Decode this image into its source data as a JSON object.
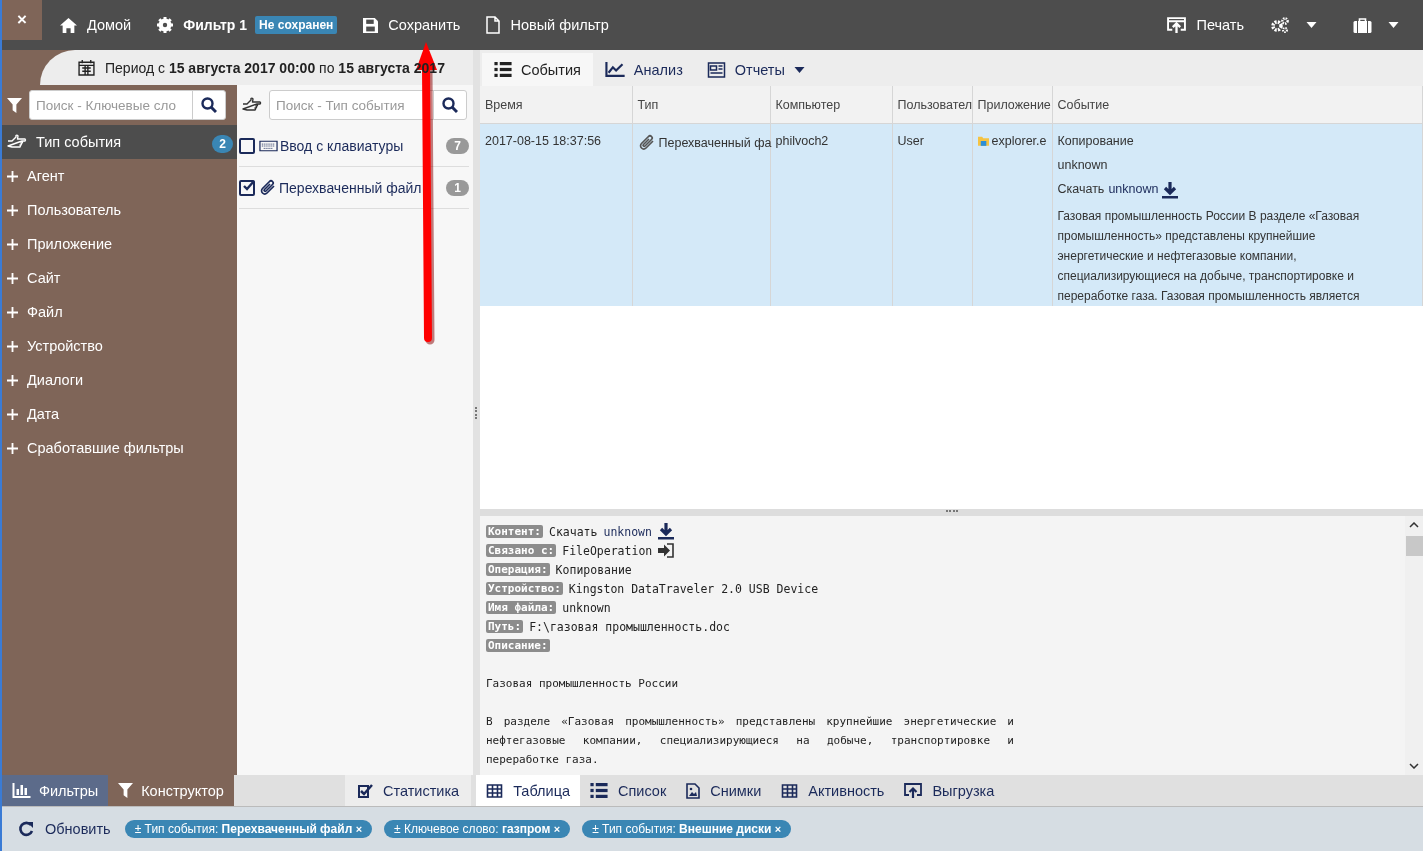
{
  "topbar": {
    "close": "×",
    "home": "Домой",
    "filter_name": "Фильтр 1",
    "filter_status": "Не сохранен",
    "save": "Сохранить",
    "new_filter": "Новый фильтр",
    "print": "Печать"
  },
  "period": "Период с **15 августа 2017 00:00** по **15 августа 2017**",
  "keyword_search": {
    "placeholder": "Поиск - Ключевые сло"
  },
  "type_search": {
    "placeholder": "Поиск - Тип события"
  },
  "sidebar": {
    "items": [
      {
        "label": "Тип события",
        "kind": "category",
        "selected": true,
        "badge": "2"
      },
      {
        "label": "Агент",
        "kind": "add",
        "selected": false
      },
      {
        "label": "Пользователь",
        "kind": "add",
        "selected": false
      },
      {
        "label": "Приложение",
        "kind": "add",
        "selected": false
      },
      {
        "label": "Сайт",
        "kind": "add",
        "selected": false
      },
      {
        "label": "Файл",
        "kind": "add",
        "selected": false
      },
      {
        "label": "Устройство",
        "kind": "add",
        "selected": false
      },
      {
        "label": "Диалоги",
        "kind": "add",
        "selected": false
      },
      {
        "label": "Дата",
        "kind": "add",
        "selected": false
      },
      {
        "label": "Сработавшие фильтры",
        "kind": "add",
        "selected": false
      }
    ]
  },
  "event_types": [
    {
      "label": "Ввод с клавиатуры",
      "kind": "keyboard",
      "count": "7",
      "checked": false
    },
    {
      "label": "Перехваченный файл",
      "kind": "attachment",
      "count": "1",
      "checked": true
    }
  ],
  "view_tabs": [
    {
      "label": "События",
      "kind": "list",
      "selected": true,
      "dropdown": false
    },
    {
      "label": "Анализ",
      "kind": "chart",
      "selected": false,
      "dropdown": false
    },
    {
      "label": "Отчеты",
      "kind": "report",
      "selected": false,
      "dropdown": true
    }
  ],
  "table": {
    "columns": [
      "Время",
      "Тип",
      "Компьютер",
      "Пользовател",
      "Приложение",
      "Событие"
    ],
    "rows": [
      {
        "selected": true,
        "time": "2017-08-15 18:37:56",
        "type": "Перехваченный фа",
        "computer": "philvoch2",
        "user": "User",
        "app": "explorer.e",
        "operation": "Копирование",
        "name": "unknown",
        "download_prefix": "Скачать",
        "download_link": "unknown",
        "description": "Газовая промышленность России В разделе «Газовая промышленность» представлены крупнейшие энергетические и нефтегазовые компании, специализирующиеся на добыче, транспортировке и переработке газа. Газовая промышленность является"
      }
    ]
  },
  "details": {
    "fields": [
      {
        "label": "Контент:",
        "kind": "download",
        "prefix": "Скачать",
        "value": "unknown"
      },
      {
        "label": "Связано с:",
        "kind": "link",
        "value": "FileOperation"
      },
      {
        "label": "Операция:",
        "kind": "text",
        "value": "Копирование"
      },
      {
        "label": "Устройство:",
        "kind": "text",
        "value": "Kingston DataTraveler 2.0 USB Device"
      },
      {
        "label": "Имя файла:",
        "kind": "text",
        "value": "unknown"
      },
      {
        "label": "Путь:",
        "kind": "text",
        "value": "F:\\газовая промышленность.doc"
      },
      {
        "label": "Описание:",
        "kind": "text"
      }
    ],
    "paragraphs": [
      "Газовая промышленность России",
      "В разделе «Газовая промышленность» представлены крупнейшие энергетические и нефтегазовые компании, специализирующиеся на добыче, транспортировке и переработке газа."
    ]
  },
  "left_tabs": [
    {
      "label": "Фильтры",
      "kind": "bars",
      "selected": true
    },
    {
      "label": "Конструктор",
      "kind": "filter",
      "selected": false
    }
  ],
  "bottom_tabs": [
    {
      "label": "Статистика",
      "kind": "check",
      "selected": false
    },
    {
      "label": "Таблица",
      "kind": "table",
      "selected": true
    },
    {
      "label": "Список",
      "kind": "list",
      "selected": false
    },
    {
      "label": "Снимки",
      "kind": "image",
      "selected": false
    },
    {
      "label": "Активность",
      "kind": "grid",
      "selected": false
    },
    {
      "label": "Выгрузка",
      "kind": "export",
      "selected": false
    }
  ],
  "status_bar": {
    "refresh": "Обновить",
    "chips": [
      {
        "label": "± Тип события:",
        "value": "Перехваченный файл",
        "close": "×"
      },
      {
        "label": "± Ключевое слово:",
        "value": "газпром",
        "close": "×"
      },
      {
        "label": "± Тип события:",
        "value": "Внешние диски",
        "close": "×"
      }
    ]
  }
}
